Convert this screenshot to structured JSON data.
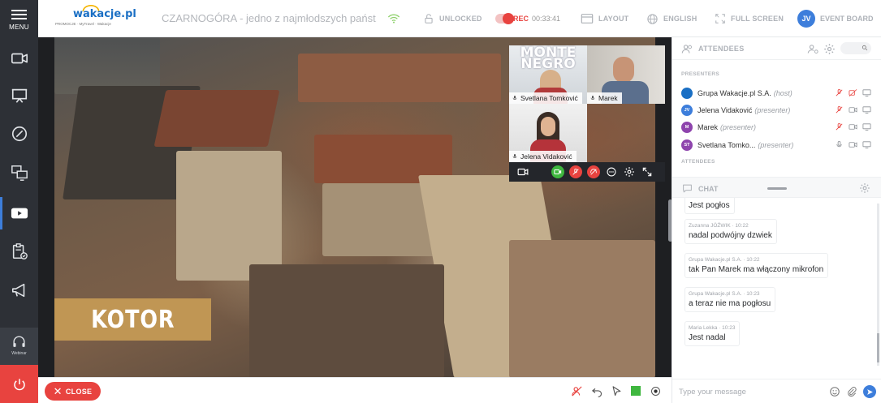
{
  "sidebar": {
    "menu_label": "MENU",
    "items": [
      {
        "icon": "video-camera-icon"
      },
      {
        "icon": "presentation-icon"
      },
      {
        "icon": "compass-icon"
      },
      {
        "icon": "screen-share-icon"
      },
      {
        "icon": "youtube-icon"
      },
      {
        "icon": "clipboard-check-icon"
      },
      {
        "icon": "megaphone-icon"
      }
    ],
    "webinar_label": "Webinar"
  },
  "topbar": {
    "logo_text": "wakacje.pl",
    "logo_partners": "PROMOCJE · MyTravel · Wakacje",
    "room_title": "CZARNOGÓRA - jedno z najmłodszych państ...",
    "unlocked_label": "UNLOCKED",
    "rec_label": "REC",
    "rec_time": "00:33:41",
    "layout_label": "LAYOUT",
    "language_label": "ENGLISH",
    "fullscreen_label": "FULL SCREEN",
    "user_initials": "JV",
    "event_board_label": "EVENT BOARD"
  },
  "stage": {
    "banner_text": "KOTOR",
    "cams": [
      {
        "name": "Svetlana Tomković",
        "overlay": "MONTE NEGRO"
      },
      {
        "name": "Marek"
      },
      {
        "name": "Jelena Vidaković"
      }
    ]
  },
  "bottombar": {
    "close_label": "CLOSE",
    "color_swatch": "#3fb73f"
  },
  "attendees_panel": {
    "title": "ATTENDEES",
    "presenters_label": "PRESENTERS",
    "attendees_label": "ATTENDEES",
    "presenters": [
      {
        "initials": "",
        "name": "Grupa Wakacje.pl S.A.",
        "role": "(host)",
        "color": "#1a6fc4"
      },
      {
        "initials": "JV",
        "name": "Jelena Vidaković",
        "role": "(presenter)",
        "color": "#3d7edb"
      },
      {
        "initials": "M",
        "name": "Marek",
        "role": "(presenter)",
        "color": "#8e44ad"
      },
      {
        "initials": "ST",
        "name": "Svetlana Tomko...",
        "role": "(presenter)",
        "color": "#8e44ad"
      }
    ]
  },
  "chat": {
    "title": "CHAT",
    "messages": [
      {
        "who": "",
        "text": "Jest pogłos"
      },
      {
        "who": "Zuzanna JÓŹWIK · 10:22",
        "text": "nadal podwójny dzwiek"
      },
      {
        "who": "Grupa Wakacje.pl S.A. · 10:22",
        "text": "tak Pan Marek ma włączony mikrofon"
      },
      {
        "who": "Grupa Wakacje.pl S.A. · 10:23",
        "text": "a teraz nie ma pogłosu"
      },
      {
        "who": "Maria Lekka · 10:23",
        "text": "Jest nadal"
      }
    ],
    "input_placeholder": "Type your message"
  },
  "colors": {
    "sidebar_bg": "#2d3036",
    "accent_blue": "#3d7edb",
    "danger_red": "#e8433f",
    "banner_gold": "#c09654"
  }
}
